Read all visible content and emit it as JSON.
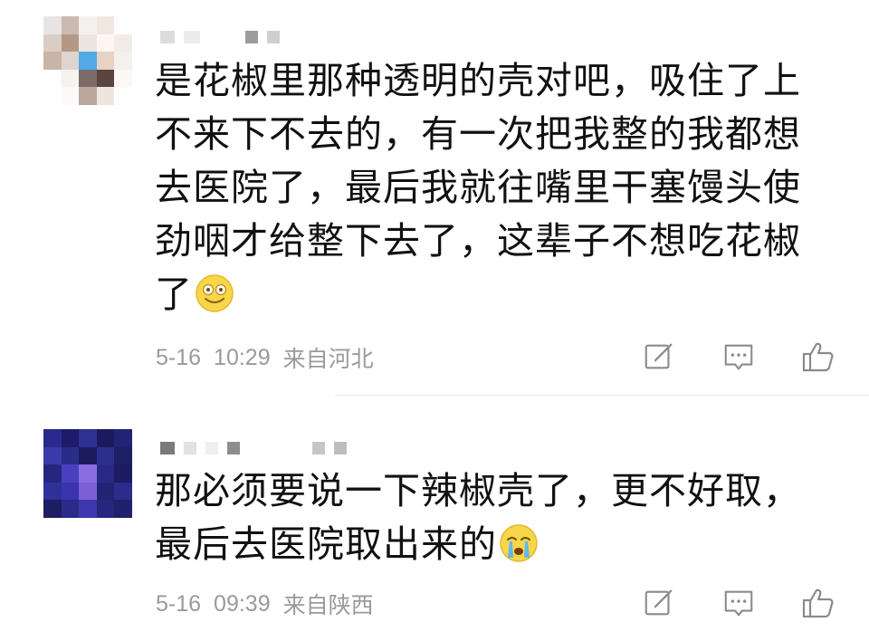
{
  "comments": [
    {
      "text": "是花椒里那种透明的壳对吧，吸住了上不来下不去的，有一次把我整的我都想去医院了，最后我就往嘴里干塞馒头使劲咽才给整下去了，这辈子不想吃花椒了",
      "emoji_icon": "dizzy-smile-face-icon",
      "date": "5-16",
      "time": "10:29",
      "location": "来自河北",
      "actions": [
        "edit-icon",
        "comment-icon",
        "like-icon"
      ]
    },
    {
      "text": "那必须要说一下辣椒壳了，更不好取，最后去医院取出来的",
      "emoji_icon": "crying-face-icon",
      "date": "5-16",
      "time": "09:39",
      "location": "来自陕西",
      "actions": [
        "edit-icon",
        "comment-icon",
        "like-icon"
      ]
    }
  ],
  "colors": {
    "text": "#111111",
    "meta": "#9a9a9a",
    "icon": "#8a8a8a",
    "divider": "#e6e6e6"
  }
}
